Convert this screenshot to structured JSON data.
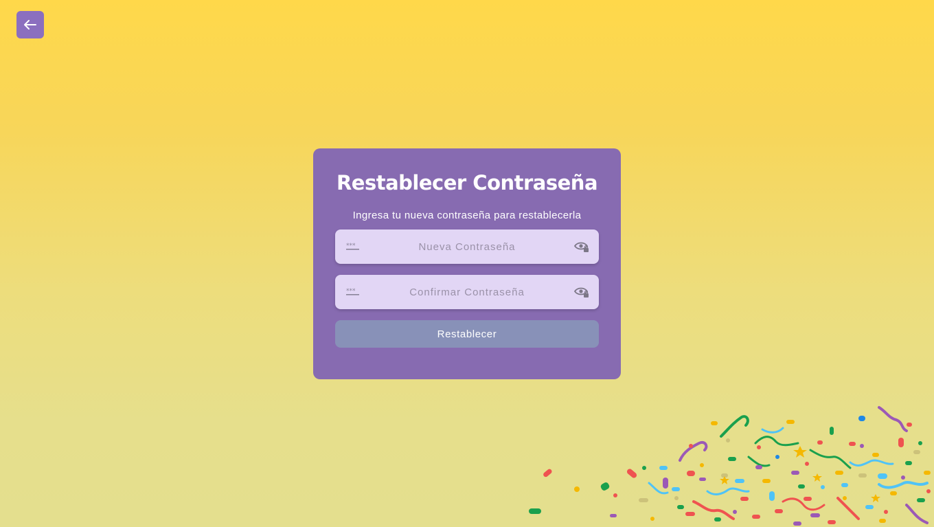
{
  "colors": {
    "background_top": "#ffd84a",
    "background_bottom": "#e4df8e",
    "card": "#876bb1",
    "field": "#e2d6f5",
    "button": "#8891b8",
    "back_button": "#8b6fbf"
  },
  "header": {
    "back_icon": "arrow-left-icon"
  },
  "card": {
    "title": "Restablecer Contraseña",
    "subtitle": "Ingresa tu nueva contraseña para restablecerla",
    "new_password": {
      "placeholder": "Nueva Contraseña",
      "value": "",
      "leading_icon": "password-dots-icon",
      "trailing_icon": "eye-lock-icon"
    },
    "confirm_password": {
      "placeholder": "Confirmar Contraseña",
      "value": "",
      "leading_icon": "password-dots-icon",
      "trailing_icon": "eye-lock-icon"
    },
    "submit_label": "Restablecer"
  },
  "decoration": {
    "icon": "confetti-icon"
  }
}
